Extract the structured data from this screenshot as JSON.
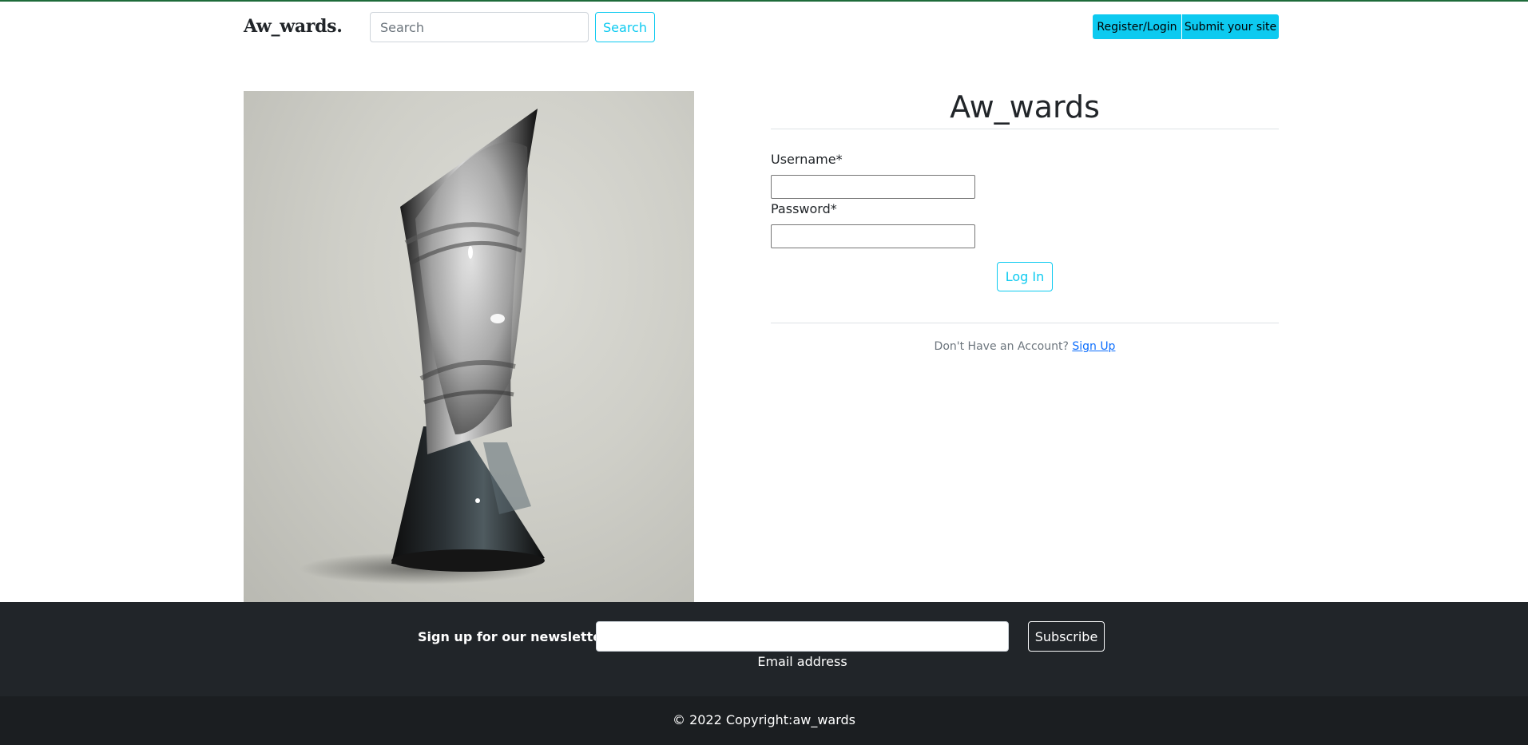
{
  "header": {
    "brand": "Aw_wards.",
    "search": {
      "placeholder": "Search",
      "button_label": "Search"
    },
    "register_login_label": "Register/Login",
    "submit_site_label": "Submit your site"
  },
  "hero_image": {
    "icon": "trophy-image"
  },
  "login": {
    "title": "Aw_wards",
    "username_label": "Username*",
    "username_value": "",
    "password_label": "Password*",
    "password_value": "",
    "login_button": "Log In",
    "no_account_text": "Don't Have an Account?",
    "signup_link": "Sign Up"
  },
  "footer": {
    "newsletter_label": "Sign up for our newsletter",
    "email_value": "",
    "email_caption": "Email address",
    "subscribe_label": "Subscribe",
    "copyright": "© 2022 Copyright:aw_wards"
  },
  "colors": {
    "accent": "#0dcaf0",
    "link": "#0d6efd",
    "footer_dark": "#212529",
    "top_accent": "#1e6b3a"
  }
}
